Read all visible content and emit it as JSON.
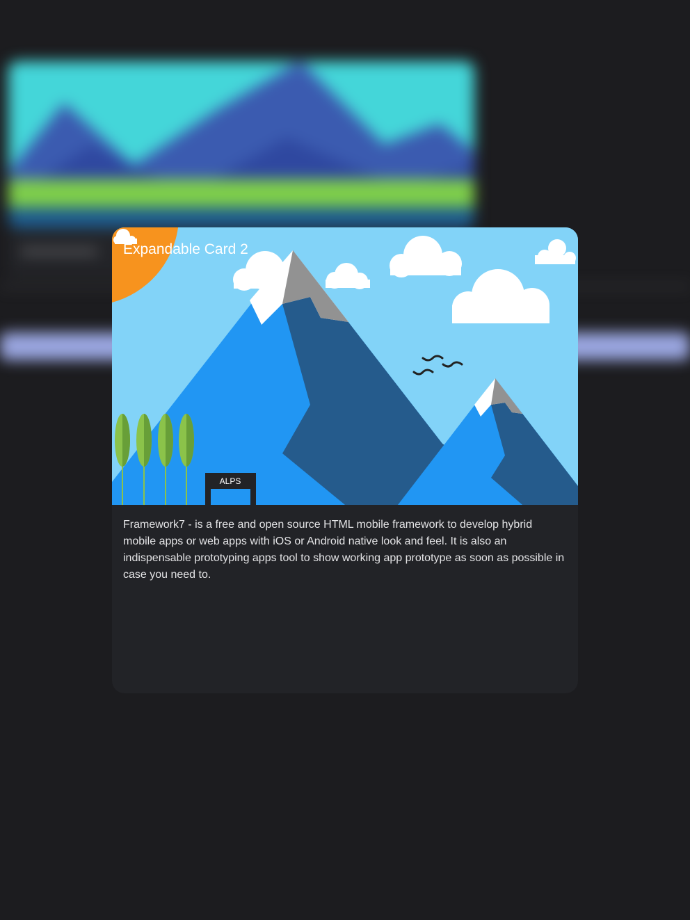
{
  "card": {
    "title": "Expandable Card 2",
    "image_sign": "ALPS",
    "description": "Framework7 - is a free and open source HTML mobile framework to develop hybrid mobile apps or web apps with iOS or Android native look and feel. It is also an indispensable prototyping apps tool to show working app prototype as soon as possible in case you need to."
  },
  "colors": {
    "page_background": "#1c1c1f",
    "card_background": "#222327",
    "sky": "#82d3f8",
    "sun": "#f7931e",
    "mountain_light": "#2196f3",
    "mountain_dark": "#255b8c",
    "tree": "#8bc34a",
    "backdrop_button": "#9aa6e0"
  },
  "icons": {
    "image_illustration": "mountain-landscape-illustration",
    "backdrop_illustration": "blurred-landscape-illustration"
  }
}
